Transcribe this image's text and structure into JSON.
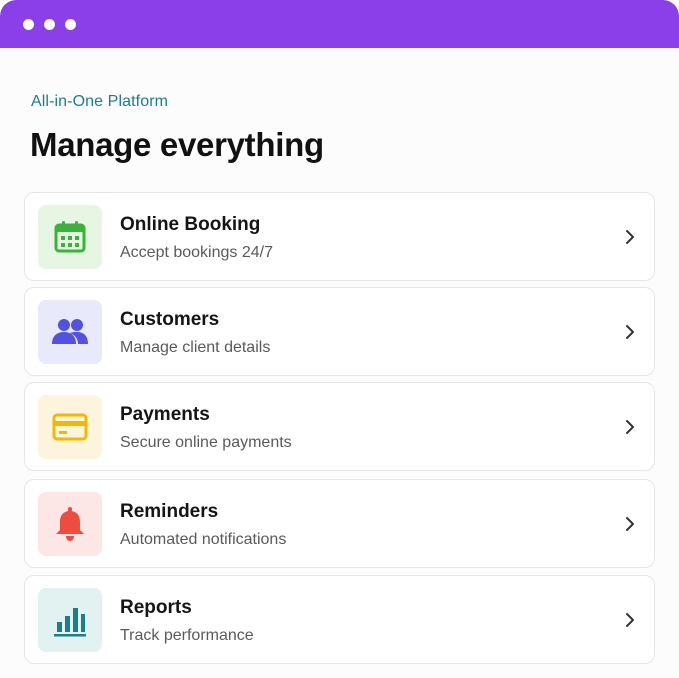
{
  "header": {
    "eyebrow": "All-in-One Platform",
    "title": "Manage everything"
  },
  "colors": {
    "titlebar": "#8b3fe9",
    "eyebrow": "#1b7f86"
  },
  "features": [
    {
      "title": "Online Booking",
      "subtitle": "Accept bookings 24/7",
      "icon": "calendar-icon",
      "icon_color": "#3bb33b",
      "tile_color": "#e6f6e3"
    },
    {
      "title": "Customers",
      "subtitle": "Manage client details",
      "icon": "users-icon",
      "icon_color": "#5252e0",
      "tile_color": "#e8e9fb"
    },
    {
      "title": "Payments",
      "subtitle": "Secure online payments",
      "icon": "credit-card-icon",
      "icon_color": "#f1b900",
      "tile_color": "#fdf4dd"
    },
    {
      "title": "Reminders",
      "subtitle": "Automated notifications",
      "icon": "bell-icon",
      "icon_color": "#f04b3f",
      "tile_color": "#fde7e6"
    },
    {
      "title": "Reports",
      "subtitle": "Track performance",
      "icon": "bar-chart-icon",
      "icon_color": "#1b7f86",
      "tile_color": "#e2f2f1"
    }
  ]
}
